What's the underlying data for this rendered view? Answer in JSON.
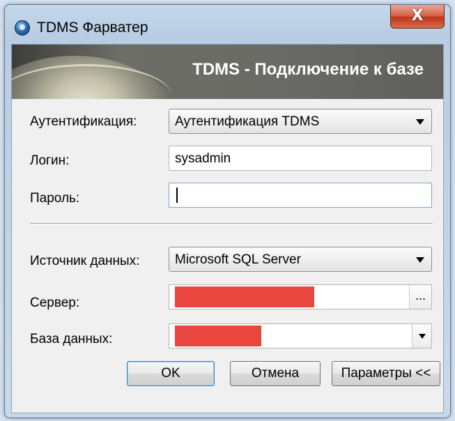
{
  "window": {
    "title": "TDMS Фарватер",
    "close_label": "X"
  },
  "banner": {
    "title": "TDMS - Подключение к базе"
  },
  "form": {
    "auth_label": "Аутентификация:",
    "auth_value": "Аутентификация TDMS",
    "login_label": "Логин:",
    "login_value": "sysadmin",
    "password_label": "Пароль:",
    "password_value": "",
    "datasource_label": "Источник данных:",
    "datasource_value": "Microsoft SQL Server",
    "server_label": "Сервер:",
    "server_browse_label": "...",
    "database_label": "База данных:"
  },
  "redaction_color": "#e8463f",
  "buttons": {
    "ok": "OK",
    "cancel": "Отмена",
    "params": "Параметры <<"
  }
}
